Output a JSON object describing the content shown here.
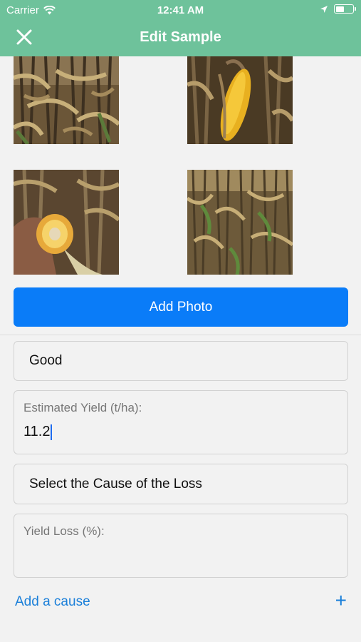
{
  "status_bar": {
    "carrier": "Carrier",
    "time": "12:41 AM"
  },
  "header": {
    "title": "Edit Sample"
  },
  "photos": [
    {
      "label": "corn-field-stalks-photo"
    },
    {
      "label": "corn-ear-on-stalk-photo"
    },
    {
      "label": "corn-cob-cross-section-photo"
    },
    {
      "label": "corn-field-rows-photo"
    }
  ],
  "actions": {
    "add_photo": "Add Photo",
    "add_cause": "Add a cause",
    "add_icon": "+"
  },
  "form": {
    "condition": "Good",
    "estimated_yield_label": "Estimated Yield (t/ha):",
    "estimated_yield_value": "11.2",
    "cause_select": "Select the Cause of the Loss",
    "yield_loss_label": "Yield Loss (%):",
    "yield_loss_value": ""
  },
  "colors": {
    "header": "#6ec29b",
    "primary_button": "#0a7cf8",
    "link": "#1a7fd9"
  }
}
